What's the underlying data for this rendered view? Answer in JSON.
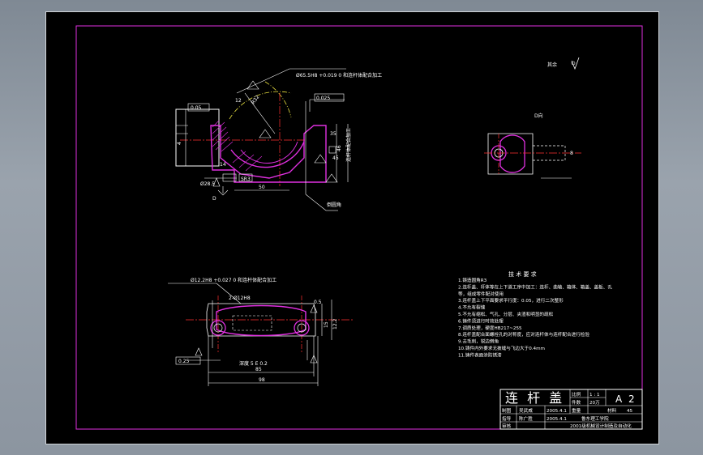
{
  "sheet": {
    "roughness_note": "其余",
    "view_label": "D向",
    "section_label": "D"
  },
  "top_view": {
    "tol_callout": "Ø65.5H8 +0.019 0  和连杆体配合加工",
    "flatness": "0.025",
    "perp_box": "0.05",
    "dim_35": "35",
    "dim_50": "50",
    "sr_label": "SR3",
    "dim_46": "46",
    "dim_45": "45",
    "dia_28": "Ø28.5",
    "dim_14": "14",
    "dim_r": "R",
    "note_right": "连杆体配合加工",
    "leader_note": "倒圆角",
    "radius_label": "R32",
    "dim_12": "12",
    "dim_4": "4"
  },
  "bottom_view": {
    "hole_callout": "Ø12.2H8 +0.027 0  和连杆体配合加工",
    "hole_dims": "2-Ø12H8",
    "position_box": "0.25",
    "side_tol": "0.5",
    "depth_label": "深度 5 E 0.2",
    "dim_85": "85",
    "dim_98": "98",
    "dim_12": "12.2",
    "dim_15": "15"
  },
  "tech": {
    "title": "技 术 要 求",
    "items": [
      "1.铸造圆角R3",
      "2.连杆盖、杆体等在上下道工序中加工：连杆、曲轴、箱体、箱盖、盖板、孔",
      "  等，组成零件配对使用",
      "3.连杆盖上下平面要求平行度：0.05，进行二次整形",
      "4.不允有裂缝",
      "5.不允有缩松、气孔、分层、夹渣和明显的疏松",
      "6.铸件须进行时效处理",
      "7.调质处理，硬度HB217~255",
      "8.连杆盖配合面螺栓孔的对称度，应对连杆体与连杆配合进行检验",
      "9.去毛刺，锐边倒角",
      "10.铸件内外要求无披缝与飞边大于0.4mm",
      "11.铸件表面涂防锈漆"
    ]
  },
  "title_block": {
    "part_name": "连 杆 盖",
    "ratio_label": "比例",
    "ratio_value": "1 : 1",
    "sheet_code": "A 2",
    "qty_label": "件数",
    "qty_value": "20万",
    "weight_label": "重量",
    "material_label": "材料",
    "material_value": "45",
    "drawn_label": "制图",
    "drawn_name": "吴武威",
    "drawn_date": "2005.4.1",
    "checked_label": "指导",
    "checked_name": "陈广胜",
    "checked_date": "2005.4.1",
    "review_label": "审核",
    "school": "鲁东理工学院",
    "dept": "2001级机械设计制造及自动化"
  }
}
